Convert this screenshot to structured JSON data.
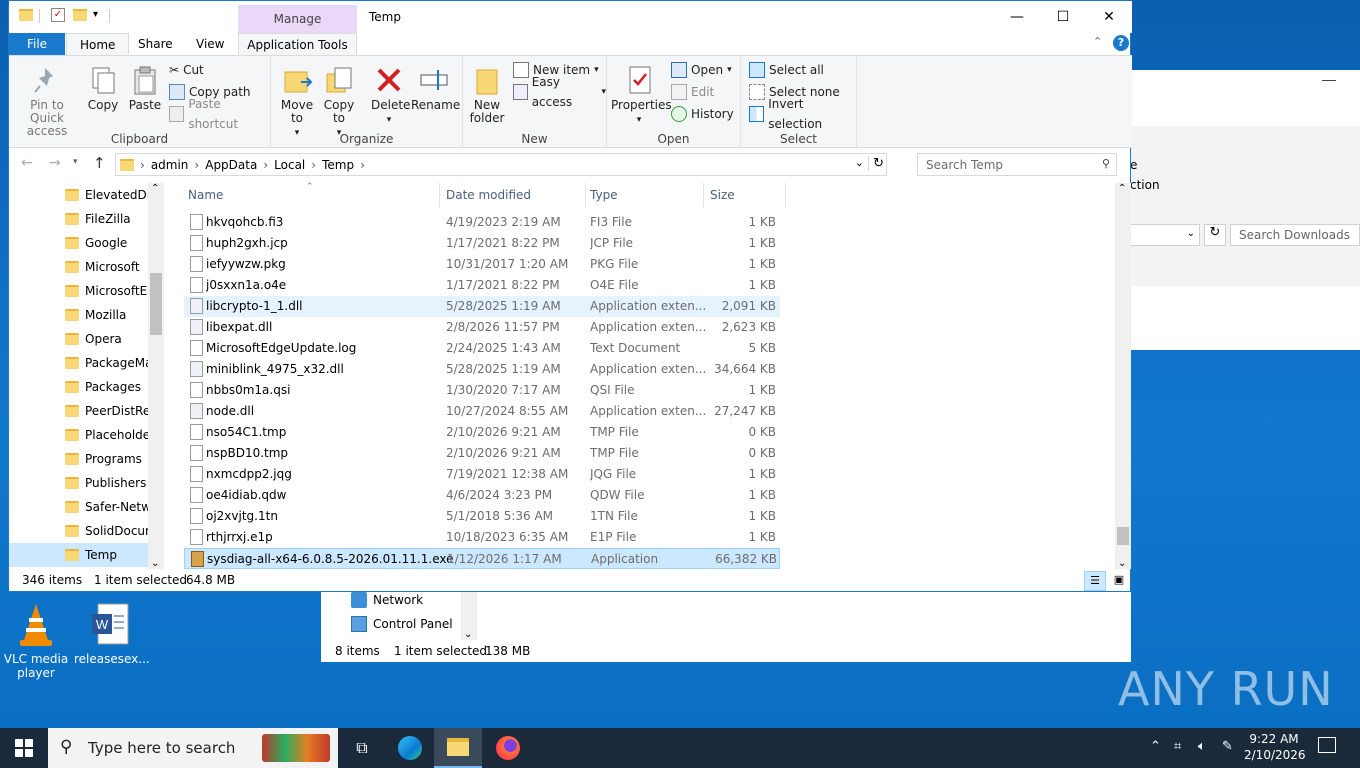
{
  "window": {
    "title": "Temp",
    "contextual_tab": "Manage",
    "tabs": [
      "File",
      "Home",
      "Share",
      "View",
      "Application Tools"
    ],
    "active_tab": "Home"
  },
  "ribbon": {
    "clipboard": {
      "label": "Clipboard",
      "pin": "Pin to Quick access",
      "copy": "Copy",
      "paste": "Paste",
      "cut": "Cut",
      "copy_path": "Copy path",
      "paste_shortcut": "Paste shortcut"
    },
    "organize": {
      "label": "Organize",
      "move_to": "Move to",
      "copy_to": "Copy to",
      "delete": "Delete",
      "rename": "Rename"
    },
    "new": {
      "label": "New",
      "new_folder": "New folder",
      "new_item": "New item",
      "easy_access": "Easy access"
    },
    "open": {
      "label": "Open",
      "properties": "Properties",
      "open": "Open",
      "edit": "Edit",
      "history": "History"
    },
    "select": {
      "label": "Select",
      "select_all": "Select all",
      "select_none": "Select none",
      "invert": "Invert selection"
    }
  },
  "address": {
    "crumbs": [
      "admin",
      "AppData",
      "Local",
      "Temp"
    ],
    "search_placeholder": "Search Temp"
  },
  "nav": {
    "items": [
      "ElevatedDia",
      "FileZilla",
      "Google",
      "Microsoft",
      "MicrosoftEc",
      "Mozilla",
      "Opera",
      "PackageMa",
      "Packages",
      "PeerDistRep",
      "Placeholder",
      "Programs",
      "Publishers",
      "Safer-Netwo",
      "SolidDocum",
      "Temp"
    ],
    "selected": "Temp"
  },
  "columns": {
    "name": "Name",
    "date": "Date modified",
    "type": "Type",
    "size": "Size"
  },
  "files": [
    {
      "name": "hkvqohcb.fi3",
      "date": "4/19/2023 2:19 AM",
      "type": "FI3 File",
      "size": "1 KB",
      "kind": "file"
    },
    {
      "name": "huph2gxh.jcp",
      "date": "1/17/2021 8:22 PM",
      "type": "JCP File",
      "size": "1 KB",
      "kind": "file"
    },
    {
      "name": "iefyywzw.pkg",
      "date": "10/31/2017 1:20 AM",
      "type": "PKG File",
      "size": "1 KB",
      "kind": "file"
    },
    {
      "name": "j0sxxn1a.o4e",
      "date": "1/17/2021 8:22 PM",
      "type": "O4E File",
      "size": "1 KB",
      "kind": "file"
    },
    {
      "name": "libcrypto-1_1.dll",
      "date": "5/28/2025 1:19 AM",
      "type": "Application exten...",
      "size": "2,091 KB",
      "kind": "dll",
      "state": "hover"
    },
    {
      "name": "libexpat.dll",
      "date": "2/8/2026 11:57 PM",
      "type": "Application exten...",
      "size": "2,623 KB",
      "kind": "dll"
    },
    {
      "name": "MicrosoftEdgeUpdate.log",
      "date": "2/24/2025 1:43 AM",
      "type": "Text Document",
      "size": "5 KB",
      "kind": "file"
    },
    {
      "name": "miniblink_4975_x32.dll",
      "date": "5/28/2025 1:19 AM",
      "type": "Application exten...",
      "size": "34,664 KB",
      "kind": "dll"
    },
    {
      "name": "nbbs0m1a.qsi",
      "date": "1/30/2020 7:17 AM",
      "type": "QSI File",
      "size": "1 KB",
      "kind": "file"
    },
    {
      "name": "node.dll",
      "date": "10/27/2024 8:55 AM",
      "type": "Application exten...",
      "size": "27,247 KB",
      "kind": "dll"
    },
    {
      "name": "nso54C1.tmp",
      "date": "2/10/2026 9:21 AM",
      "type": "TMP File",
      "size": "0 KB",
      "kind": "file"
    },
    {
      "name": "nspBD10.tmp",
      "date": "2/10/2026 9:21 AM",
      "type": "TMP File",
      "size": "0 KB",
      "kind": "file"
    },
    {
      "name": "nxmcdpp2.jqg",
      "date": "7/19/2021 12:38 AM",
      "type": "JQG File",
      "size": "1 KB",
      "kind": "file"
    },
    {
      "name": "oe4idiab.qdw",
      "date": "4/6/2024 3:23 PM",
      "type": "QDW File",
      "size": "1 KB",
      "kind": "file"
    },
    {
      "name": "oj2xvjtg.1tn",
      "date": "5/1/2018 5:36 AM",
      "type": "1TN File",
      "size": "1 KB",
      "kind": "file"
    },
    {
      "name": "rthjrrxj.e1p",
      "date": "10/18/2023 6:35 AM",
      "type": "E1P File",
      "size": "1 KB",
      "kind": "file"
    },
    {
      "name": "sysdiag-all-x64-6.0.8.5-2026.01.11.1.exe",
      "date": "1/12/2026 1:17 AM",
      "type": "Application",
      "size": "66,382 KB",
      "kind": "exe",
      "state": "selected"
    }
  ],
  "status": {
    "count": "346 items",
    "selected": "1 item selected",
    "size": "64.8 MB"
  },
  "window2": {
    "items": [
      "Network",
      "Control Panel"
    ],
    "count": "8 items",
    "selected": "1 item selected",
    "size": "138 MB"
  },
  "bg_window": {
    "frag1": "e",
    "frag2": "ction",
    "search_placeholder": "Search Downloads"
  },
  "desktop_icons": [
    {
      "label": "VLC media player"
    },
    {
      "label": "releasesex..."
    }
  ],
  "taskbar": {
    "search_placeholder": "Type here to search",
    "time": "9:22 AM",
    "date": "2/10/2026"
  },
  "watermark": "ANY RUN"
}
